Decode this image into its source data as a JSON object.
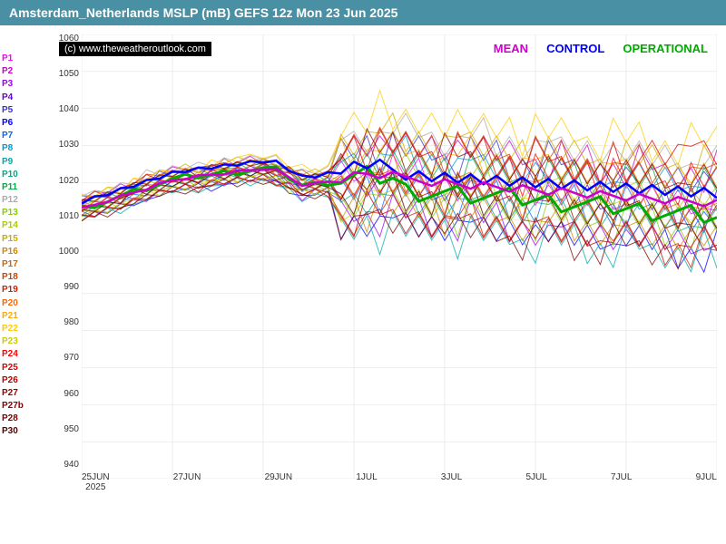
{
  "header": {
    "title": "Amsterdam_Netherlands MSLP (mB) GEFS 12z Mon 23 Jun 2025"
  },
  "watermark": "(c) www.theweatheroutlook.com",
  "legend_top": {
    "mean_label": "MEAN",
    "mean_color": "#cc00cc",
    "control_label": "CONTROL",
    "control_color": "#0000ff",
    "operational_label": "OPERATIONAL",
    "operational_color": "#00aa00"
  },
  "y_axis": {
    "labels": [
      "1060",
      "1050",
      "1040",
      "1030",
      "1020",
      "1010",
      "1000",
      "990",
      "980",
      "970",
      "960",
      "950",
      "940"
    ],
    "min": 940,
    "max": 1060
  },
  "x_axis": {
    "labels": [
      "25JUN\n2025",
      "27JUN",
      "29JUN",
      "1JUL",
      "3JUL",
      "5JUL",
      "7JUL",
      "9JUL"
    ]
  },
  "legend_items": [
    {
      "label": "P1",
      "color": "#ff00ff"
    },
    {
      "label": "P2",
      "color": "#cc00cc"
    },
    {
      "label": "P3",
      "color": "#9900ff"
    },
    {
      "label": "P4",
      "color": "#6600cc"
    },
    {
      "label": "P5",
      "color": "#3333cc"
    },
    {
      "label": "P6",
      "color": "#0000ff"
    },
    {
      "label": "P7",
      "color": "#0066ff"
    },
    {
      "label": "P8",
      "color": "#0099cc"
    },
    {
      "label": "P9",
      "color": "#00aaaa"
    },
    {
      "label": "P10",
      "color": "#00aa88"
    },
    {
      "label": "P11",
      "color": "#00aa44"
    },
    {
      "label": "P12",
      "color": "#aaaaaa"
    },
    {
      "label": "P13",
      "color": "#88cc00"
    },
    {
      "label": "P14",
      "color": "#aacc00"
    },
    {
      "label": "P15",
      "color": "#ccaa00"
    },
    {
      "label": "P16",
      "color": "#cc8800"
    },
    {
      "label": "P17",
      "color": "#cc6600"
    },
    {
      "label": "P18",
      "color": "#cc4400"
    },
    {
      "label": "P19",
      "color": "#cc2200"
    },
    {
      "label": "P20",
      "color": "#ff6600"
    },
    {
      "label": "P21",
      "color": "#ffaa00"
    },
    {
      "label": "P22",
      "color": "#ffcc00"
    },
    {
      "label": "P23",
      "color": "#cccc00"
    },
    {
      "label": "P24",
      "color": "#ff0000"
    },
    {
      "label": "P25",
      "color": "#dd0000"
    },
    {
      "label": "P26",
      "color": "#bb0000"
    },
    {
      "label": "P27",
      "color": "#990000"
    },
    {
      "label": "P27b",
      "color": "#880000"
    },
    {
      "label": "P28",
      "color": "#770000"
    },
    {
      "label": "P30",
      "color": "#550000"
    }
  ]
}
